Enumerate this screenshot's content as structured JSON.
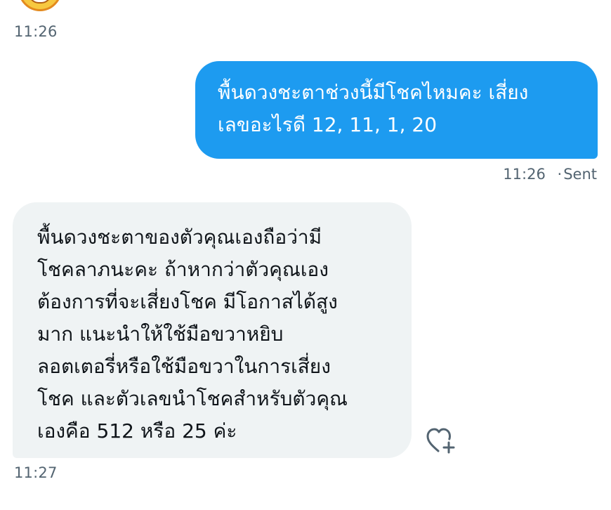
{
  "conversation": {
    "previous_message_time": "11:26",
    "sent_message": {
      "text": "พื้นดวงชะตาช่วงนี้มีโชคไหมคะ เสี่ยง\nเลขอะไรดี 12, 11, 1, 20",
      "time": "11:26",
      "status": "Sent",
      "separator": "·"
    },
    "received_message": {
      "text": "พื้นดวงชะตาของตัวคุณเองถือว่ามี\nโชคลาภนะคะ ถ้าหากว่าตัวคุณเอง\nต้องการที่จะเสี่ยงโชค มีโอกาสได้สูง\nมาก แนะนำให้ใช้มือขวาหยิบ\nลอตเตอรี่หรือใช้มือขวาในการเสี่ยง\nโชค และตัวเลขนำโชคสำหรับตัวคุณ\nเองคือ 512 หรือ 25 ค่ะ",
      "time": "11:27"
    },
    "icons": {
      "avatar": "grinning-face-emoji-icon",
      "react": "heart-plus-icon"
    }
  },
  "colors": {
    "sent_bubble": "#1d9bf0",
    "received_bubble": "#eff3f4",
    "meta_text": "#536471"
  }
}
